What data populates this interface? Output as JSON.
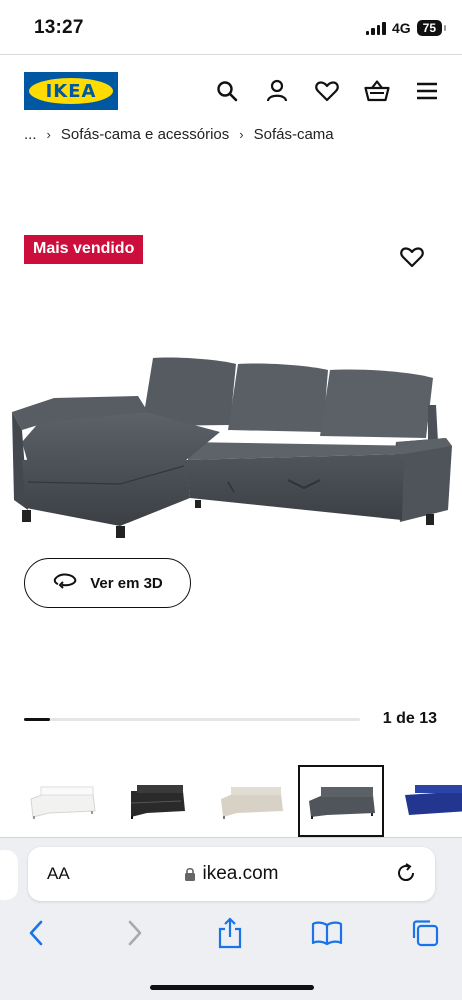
{
  "status": {
    "time": "13:27",
    "network": "4G",
    "battery": "75"
  },
  "header": {
    "logo_text": "IKEA",
    "brand_colors": {
      "blue": "#0058a3",
      "yellow": "#ffdb00"
    },
    "icons": [
      "search-icon",
      "user-icon",
      "heart-icon",
      "basket-icon",
      "menu-icon"
    ]
  },
  "breadcrumb": {
    "ellipsis": "...",
    "items": [
      "Sofás-cama e acessórios",
      "Sofás-cama"
    ]
  },
  "product": {
    "badge": "Mais vendido",
    "badge_color": "#cc0e3d",
    "view_3d_label": "Ver em 3D"
  },
  "gallery": {
    "counter": "1 de 13",
    "progress": 0.077,
    "thumbnails": [
      {
        "color": "white",
        "selected": false
      },
      {
        "color": "black",
        "selected": false
      },
      {
        "color": "beige",
        "selected": false
      },
      {
        "color": "dark-grey",
        "selected": true
      },
      {
        "color": "blue",
        "selected": false
      }
    ]
  },
  "browser": {
    "aa_label": "AA",
    "url": "ikea.com"
  }
}
